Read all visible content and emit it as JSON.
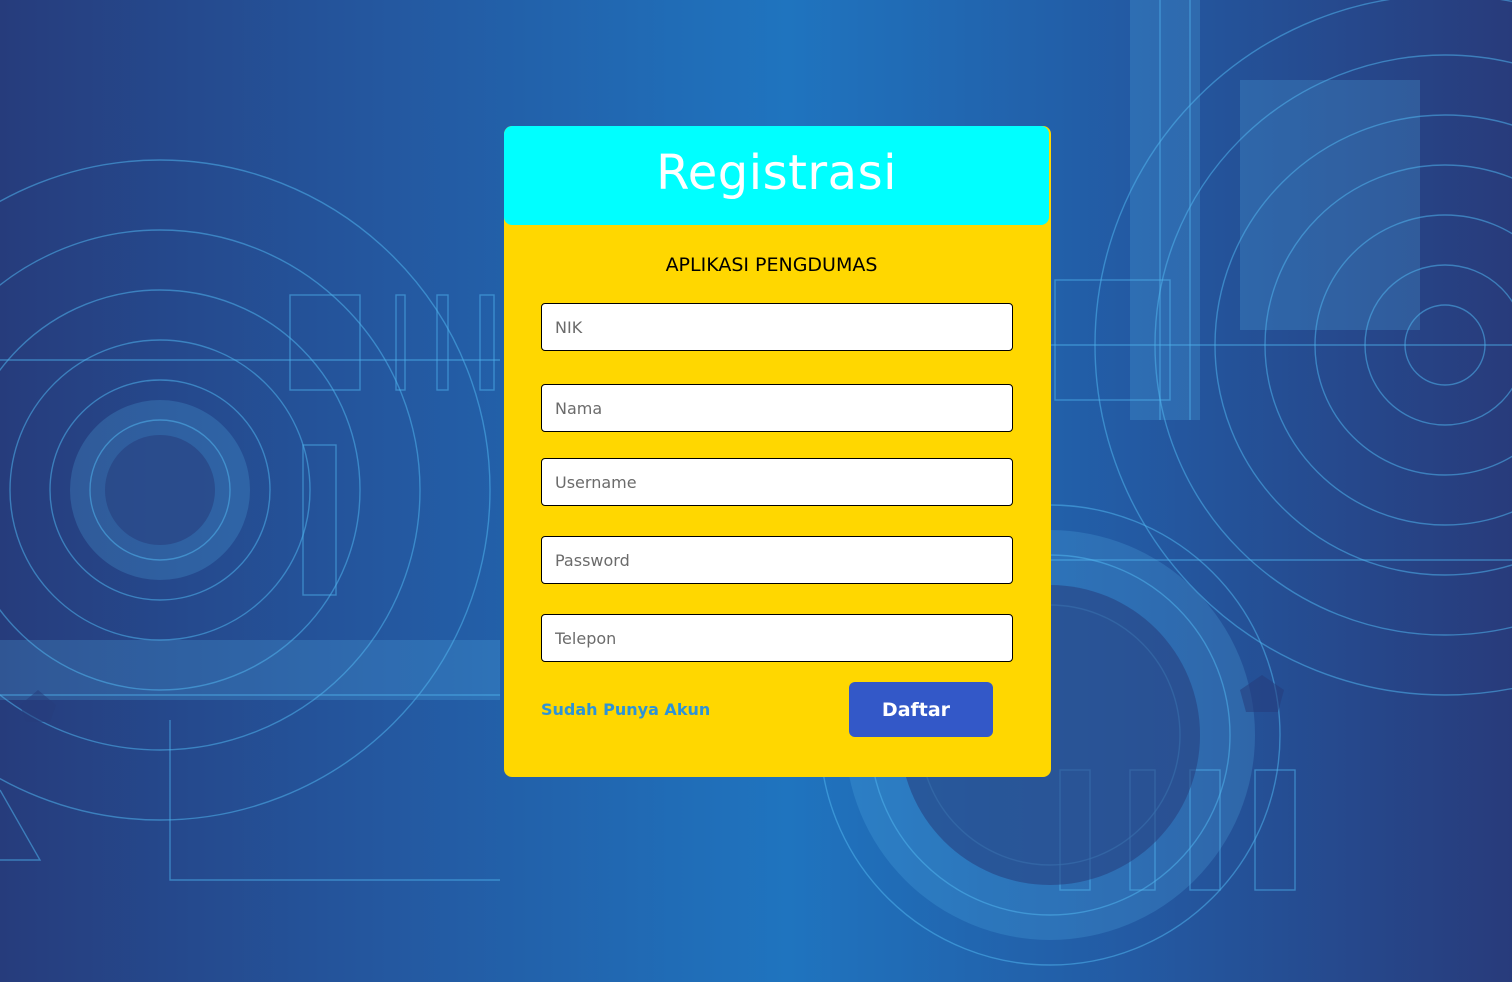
{
  "header": {
    "title": "Registrasi"
  },
  "form": {
    "subtitle": "APLIKASI PENGDUMAS",
    "fields": [
      {
        "name": "nik",
        "placeholder": "NIK",
        "value": ""
      },
      {
        "name": "nama",
        "placeholder": "Nama",
        "value": ""
      },
      {
        "name": "username",
        "placeholder": "Username",
        "value": ""
      },
      {
        "name": "password",
        "placeholder": "Password",
        "value": ""
      },
      {
        "name": "telepon",
        "placeholder": "Telepon",
        "value": ""
      }
    ],
    "login_link": "Sudah Punya Akun",
    "submit_label": "Daftar"
  },
  "colors": {
    "header": "#00ffff",
    "card": "#ffd700",
    "button": "#3358c8",
    "link": "#2e93d6"
  }
}
